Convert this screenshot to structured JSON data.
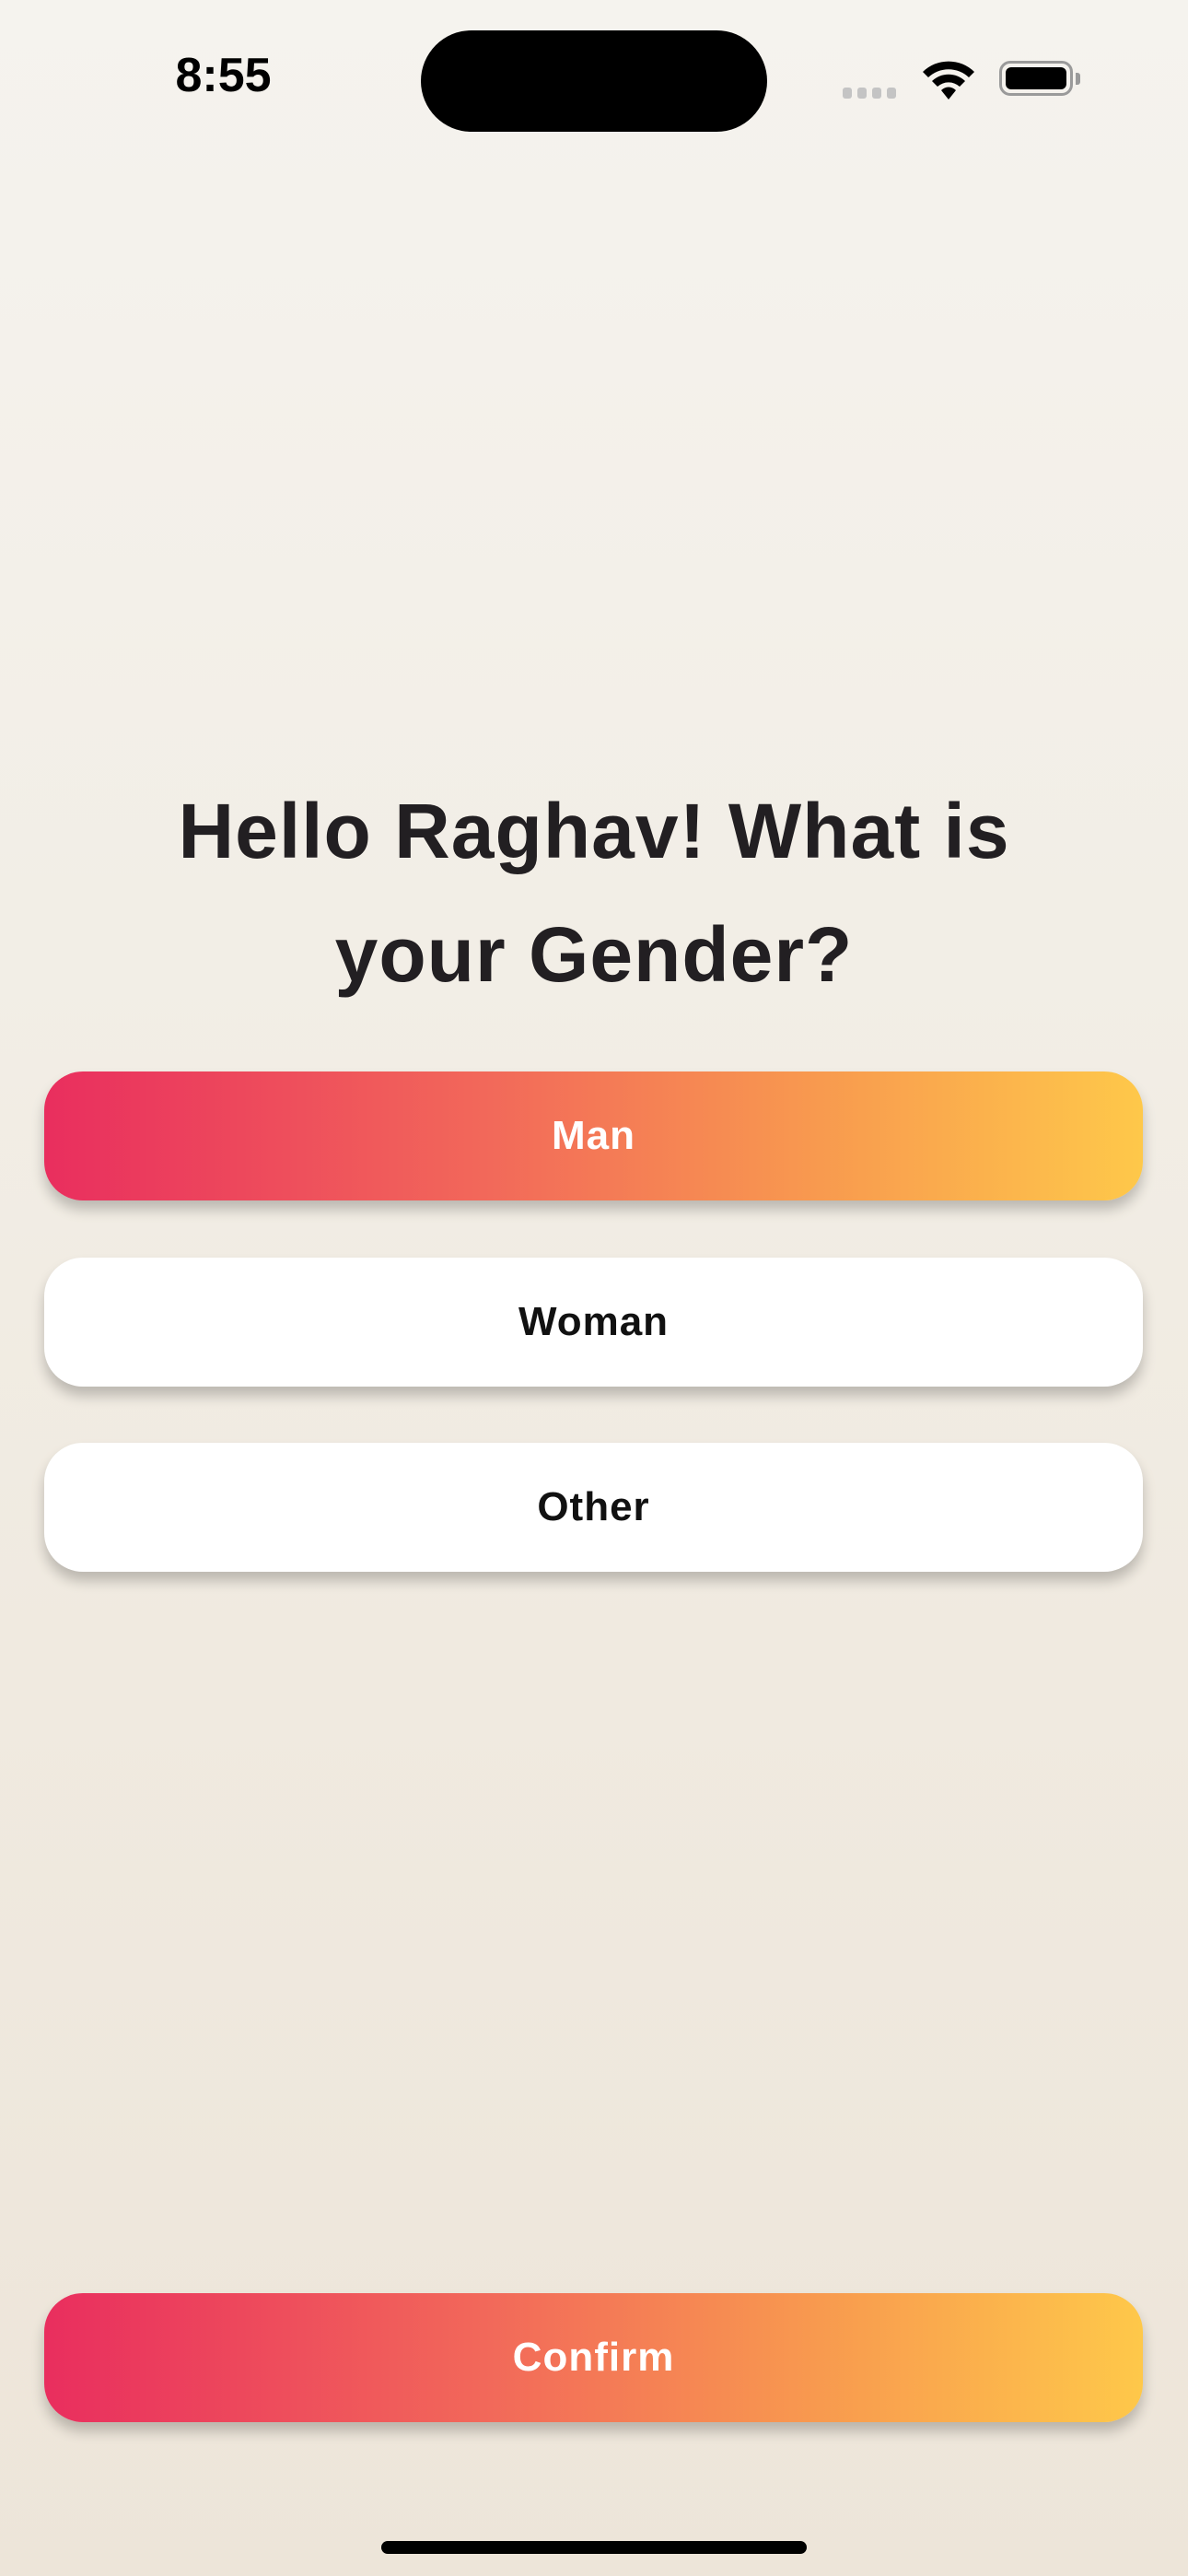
{
  "status_bar": {
    "time": "8:55",
    "icons": [
      "signal-icon",
      "wifi-icon",
      "battery-icon"
    ]
  },
  "question": {
    "title": "Hello Raghav! What is your Gender?"
  },
  "options": [
    {
      "label": "Man",
      "selected": true
    },
    {
      "label": "Woman",
      "selected": false
    },
    {
      "label": "Other",
      "selected": false
    }
  ],
  "confirm_label": "Confirm",
  "colors": {
    "gradient_start": "#e92e5e",
    "gradient_end": "#fec84a",
    "background": "#f3efe7"
  }
}
